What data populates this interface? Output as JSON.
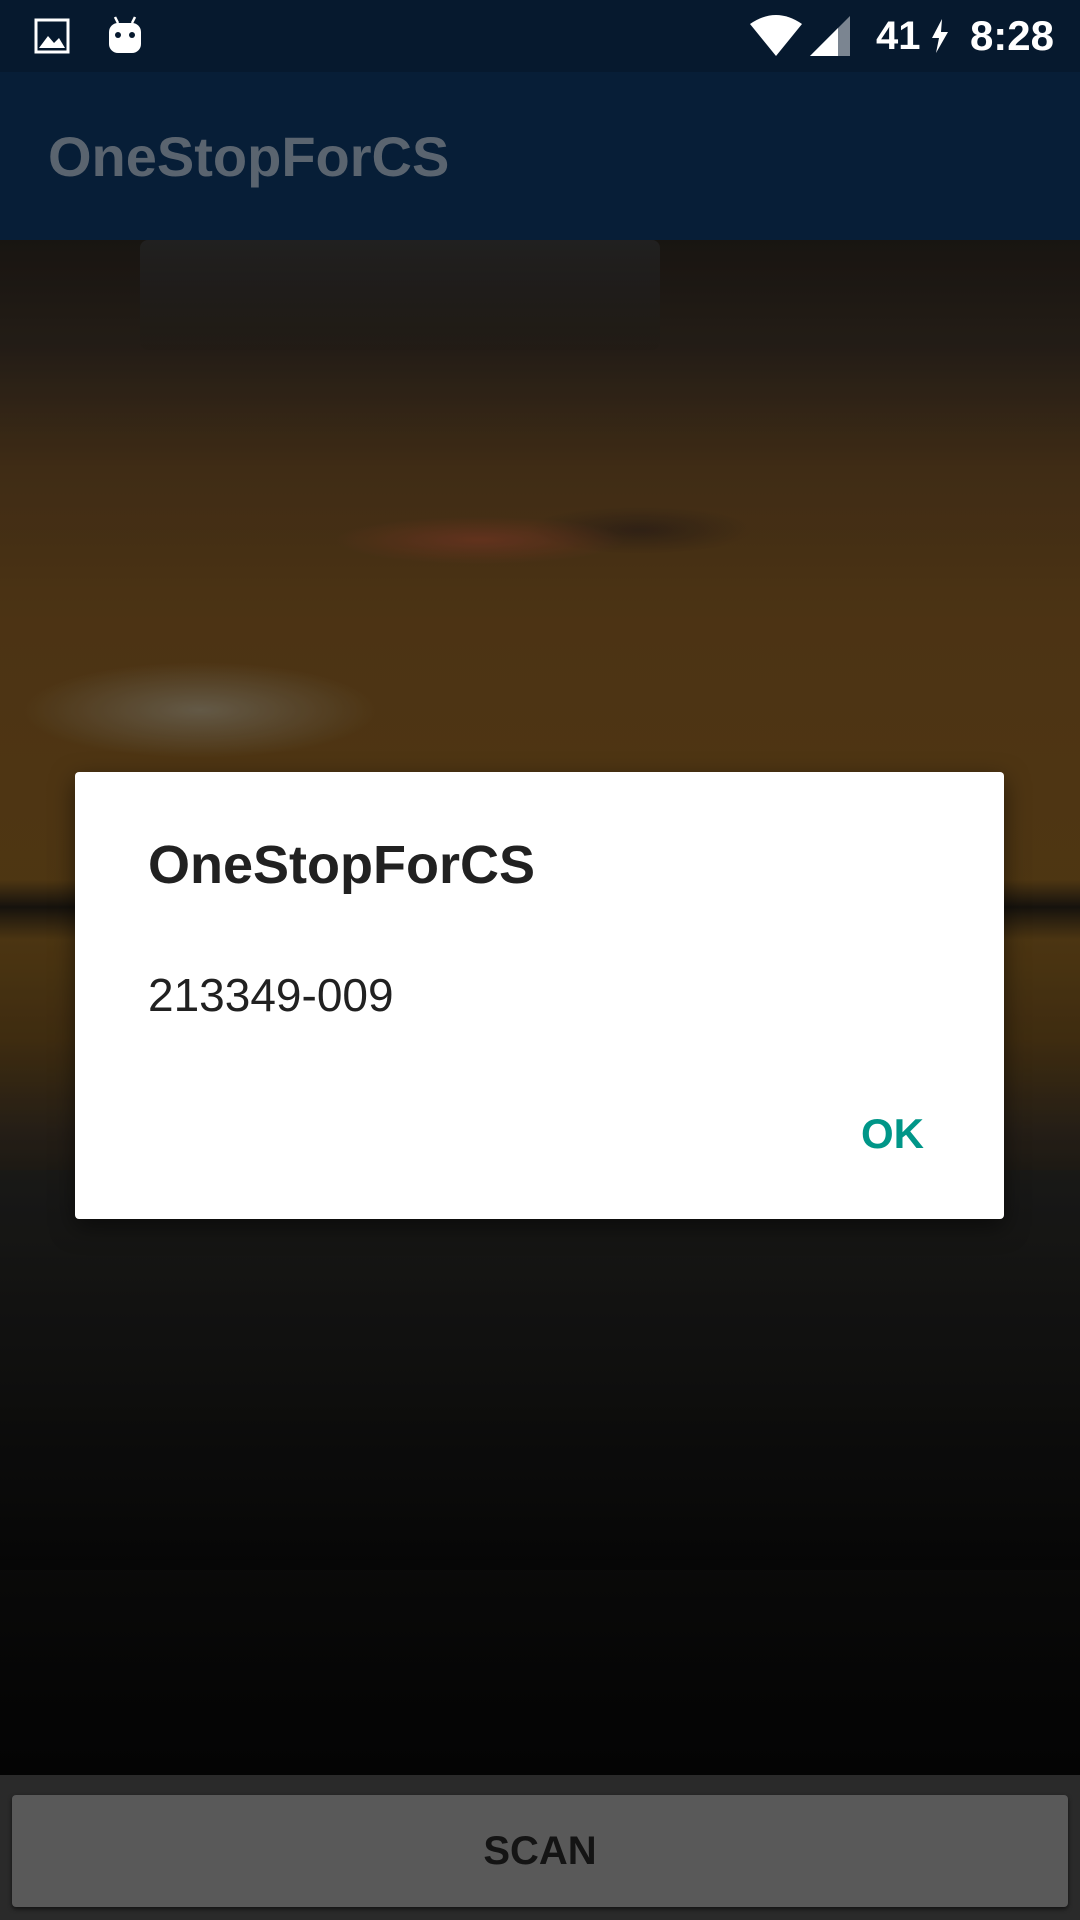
{
  "status_bar": {
    "icons": [
      "gallery-icon",
      "android-icon",
      "wifi-icon",
      "cell-signal-icon",
      "charging-bolt-icon"
    ],
    "battery_level": "41",
    "time": "8:28"
  },
  "app_bar": {
    "title": "OneStopForCS"
  },
  "dialog": {
    "title": "OneStopForCS",
    "message": "213349-009",
    "ok_label": "OK"
  },
  "bottom": {
    "scan_label": "SCAN"
  },
  "colors": {
    "status_bar_bg": "#06192e",
    "app_bar_bg": "#071e37",
    "app_title": "#5a646f",
    "dialog_ok": "#009688",
    "scan_button_bg": "#595959"
  }
}
